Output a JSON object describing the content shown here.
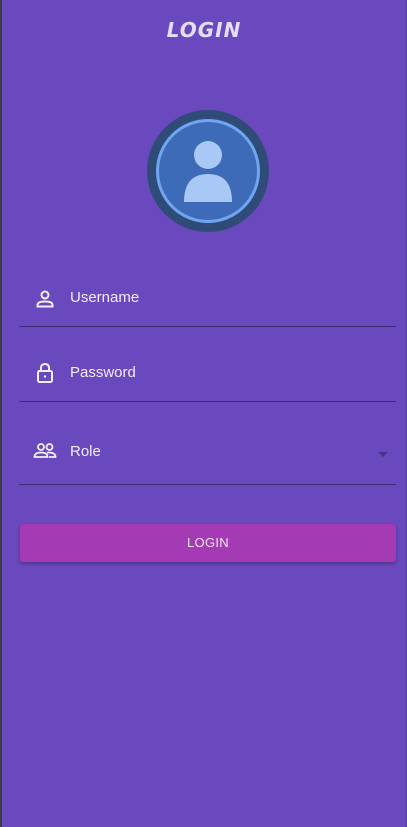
{
  "header": {
    "title": "LOGIN"
  },
  "form": {
    "username": {
      "label": "Username",
      "icon": "person-icon"
    },
    "password": {
      "label": "Password",
      "icon": "lock-icon"
    },
    "role": {
      "label": "Role",
      "icon": "people-icon"
    }
  },
  "actions": {
    "login_label": "LOGIN"
  },
  "colors": {
    "background": "#6a48bd",
    "button": "#a43bb4",
    "avatar_ring": "#2f4c78",
    "avatar_fill": "#3e6bb8"
  }
}
